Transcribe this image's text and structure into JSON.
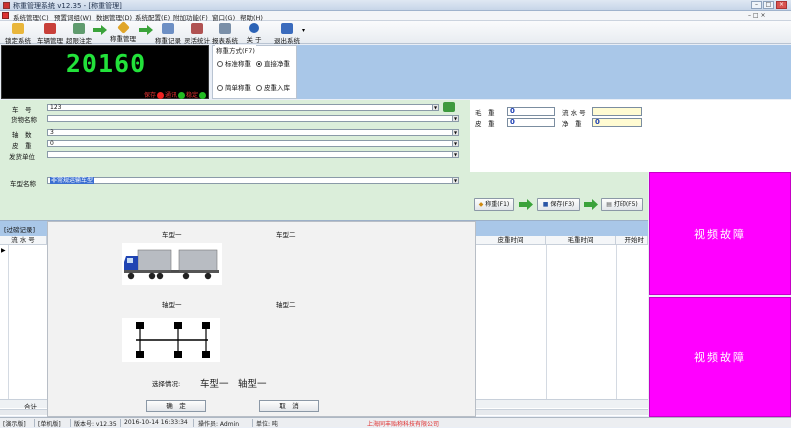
{
  "window": {
    "title": "称重管理系统 v12.35 - [称重管理]"
  },
  "menu": [
    "系统管理(C)",
    "预置词组(W)",
    "数据管理(D)",
    "系统配置(E)",
    "附加功能(F)",
    "窗口(G)",
    "帮助(H)"
  ],
  "toolbar": {
    "lock": "锁定系统",
    "vehicle": "车辆管理",
    "cancel_weigh": "超限注定",
    "weigh_mgmt": "称重管理",
    "weigh_records": "称重记录",
    "flexible_stats": "灵活统计",
    "report_system": "报表系统",
    "about": "关 于",
    "exit": "退出系统"
  },
  "scale": {
    "value": "20160",
    "ind_save": "保存",
    "ind_comm": "通讯",
    "ind_stable": "稳定"
  },
  "mode": {
    "legend": "称重方式(F7)",
    "std": "标准称重",
    "direct": "直接净重",
    "simple": "简单称重",
    "tare": "皮重入库",
    "selected": "direct"
  },
  "form": {
    "plate_label": "车　号",
    "plate_value": "123",
    "goods_label": "货物名称",
    "goods_value": "",
    "axles_label": "轴　数",
    "axles_value": "3",
    "tare_label": "皮　重",
    "tare_value": "0",
    "sender_label": "发货单位",
    "sender_value": "",
    "vtype_label": "车型名称",
    "vtype_value": "非常规运输车型"
  },
  "weights": {
    "gross_label": "毛　重",
    "gross_value": "0",
    "tare_label": "皮　重",
    "tare_value": "0",
    "serial_label": "流 水 号",
    "serial_value": "",
    "net_label": "净　重",
    "net_value": "0"
  },
  "actions": {
    "weigh": "称重(F1)",
    "save": "保存(F3)",
    "print": "打印(F5)"
  },
  "video": {
    "panel1": "视频故障",
    "panel2": "视频故障"
  },
  "records": {
    "tab": "[过磅记录]",
    "col_serial": "流 水 号",
    "col_tare_time": "皮重时间",
    "col_gross_time": "毛重时间",
    "col_start": "开始时",
    "sum_label": "合计"
  },
  "popup": {
    "vtype1": "车型一",
    "vtype2": "车型二",
    "atype1": "轴型一",
    "atype2": "轴型二",
    "selection_label": "选择情况:",
    "selection_value": "车型一　轴型一",
    "ok": "确　定",
    "cancel": "取　消"
  },
  "status": {
    "demo": "[演示版]",
    "edition": "[单机版]",
    "version": "版本号: v12.35",
    "datetime": "2016-10-14 16:33:34",
    "operator": "操作员: Admin",
    "unit": "单位: 吨",
    "company": "上海同丰贻称科技有限公司"
  },
  "colors": {
    "scale_digits": "#22e23a",
    "video_fault_bg": "#ff00ff",
    "form_bg": "#dbeeda",
    "header_blue": "#a9c7e8",
    "company_text": "#e03030"
  }
}
